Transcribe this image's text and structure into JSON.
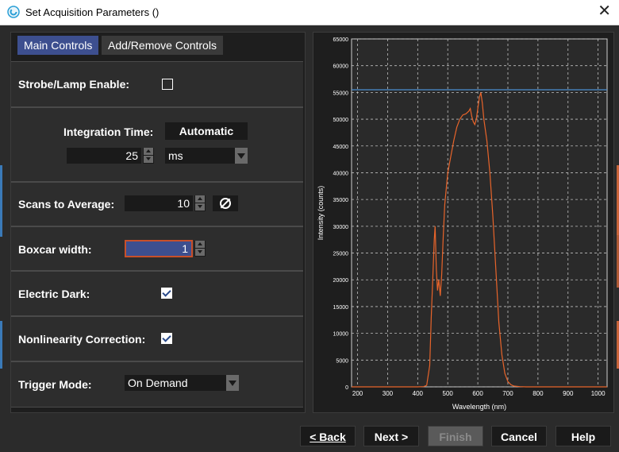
{
  "window": {
    "title": "Set Acquisition Parameters ()",
    "close": "✕"
  },
  "tabs": [
    {
      "label": "Main Controls"
    },
    {
      "label": "Add/Remove Controls"
    }
  ],
  "controls": {
    "strobe": {
      "label": "Strobe/Lamp Enable:",
      "checked": false
    },
    "integration": {
      "label": "Integration Time:",
      "auto_label": "Automatic",
      "value": "25",
      "unit": "ms"
    },
    "scans": {
      "label": "Scans to Average:",
      "value": "10"
    },
    "boxcar": {
      "label": "Boxcar width:",
      "value": "1"
    },
    "electric_dark": {
      "label": "Electric Dark:",
      "checked": true
    },
    "nonlinearity": {
      "label": "Nonlinearity Correction:",
      "checked": true
    },
    "trigger": {
      "label": "Trigger Mode:",
      "value": "On Demand"
    }
  },
  "footer": {
    "back": "< Back",
    "next": "Next >",
    "finish": "Finish",
    "cancel": "Cancel",
    "help": "Help"
  },
  "chart_data": {
    "type": "line",
    "xlabel": "Wavelength (nm)",
    "ylabel": "Intensity (counts)",
    "xlim": [
      180,
      1030
    ],
    "ylim": [
      0,
      65000
    ],
    "xticks": [
      200,
      300,
      400,
      500,
      600,
      700,
      800,
      900,
      1000
    ],
    "yticks": [
      0,
      5000,
      10000,
      15000,
      20000,
      25000,
      30000,
      35000,
      40000,
      45000,
      50000,
      55000,
      60000,
      65000
    ],
    "grid": true,
    "threshold_line": {
      "y": 55500,
      "color": "#4a8fd0"
    },
    "series": [
      {
        "color": "#e8642a",
        "x": [
          180,
          300,
          400,
          420,
          430,
          440,
          445,
          450,
          455,
          458,
          462,
          466,
          470,
          475,
          480,
          485,
          490,
          500,
          510,
          520,
          530,
          540,
          550,
          560,
          570,
          575,
          580,
          585,
          590,
          595,
          600,
          605,
          610,
          615,
          620,
          630,
          640,
          650,
          660,
          670,
          680,
          690,
          700,
          710,
          720,
          740,
          760,
          800,
          1030
        ],
        "y": [
          0,
          0,
          0,
          50,
          300,
          4000,
          13000,
          20000,
          27500,
          30000,
          22000,
          18000,
          20000,
          17000,
          21000,
          28000,
          34000,
          40000,
          43000,
          46000,
          48500,
          50000,
          50800,
          51000,
          51500,
          52000,
          50500,
          49500,
          49000,
          50000,
          52000,
          54000,
          55000,
          53000,
          50000,
          46000,
          40000,
          32000,
          22000,
          12000,
          6000,
          2500,
          1000,
          400,
          150,
          50,
          0,
          0,
          0
        ]
      }
    ]
  }
}
